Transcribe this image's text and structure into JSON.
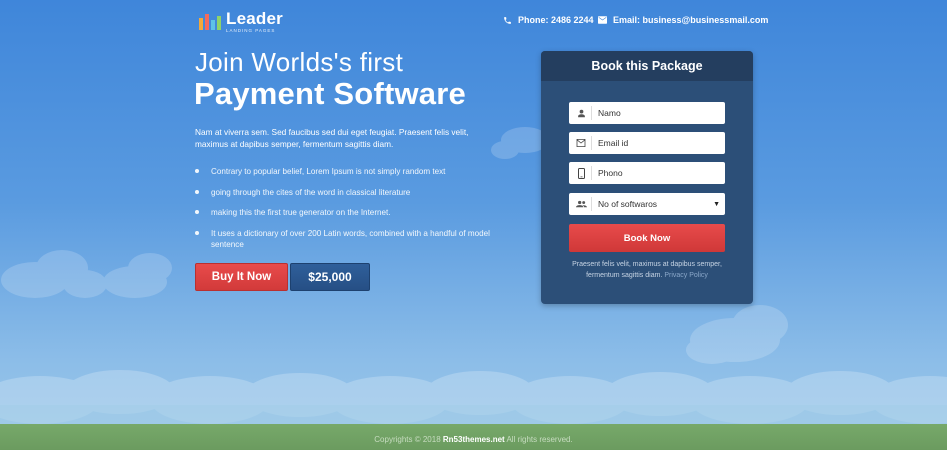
{
  "brand": {
    "name": "Leader",
    "tagline": "LANDING PAGES",
    "bar_colors": [
      "#f2a83b",
      "#f36b5e",
      "#5ec2e8",
      "#8fd36b"
    ]
  },
  "header": {
    "phone": "Phone: 2486 2244",
    "email": "Email: business@businessmail.com"
  },
  "hero": {
    "title_line1": "Join Worlds's first",
    "title_line2": "Payment Software",
    "description": "Nam at viverra sem. Sed faucibus sed dui eget feugiat. Praesent felis velit, maximus at dapibus semper, fermentum sagittis diam.",
    "features": [
      "Contrary to popular belief, Lorem Ipsum is not simply random text",
      "going through the cites of the word in classical literature",
      "making this the first true generator on the Internet.",
      "It uses a dictionary of over 200 Latin words, combined with a handful of model sentence"
    ],
    "buy_button": "Buy It Now",
    "price": "$25,000"
  },
  "booking": {
    "title": "Book this Package",
    "name_placeholder": "Namo",
    "email_placeholder": "Email id",
    "phone_placeholder": "Phono",
    "software_select": "No of softwaros",
    "submit": "Book Now",
    "note": "Praesent felis velit, maximus at dapibus semper, fermentum sagittis diam.",
    "privacy_link": "Privacy Policy"
  },
  "footer": {
    "prefix": "Copyrights © 2018",
    "site": "Rn53themes.net",
    "suffix": "All rights reserved."
  },
  "colors": {
    "accent_red": "#e04444",
    "card_blue": "#2c4f78",
    "price_blue": "#2a5890",
    "sky_top": "#3f86da"
  }
}
